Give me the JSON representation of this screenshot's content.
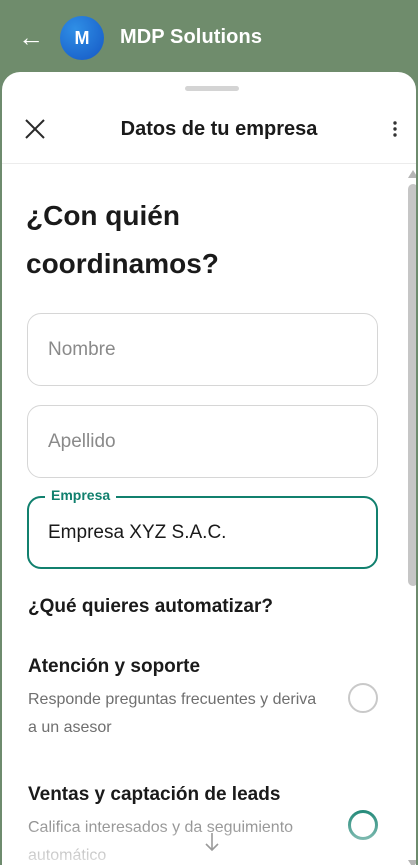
{
  "app": {
    "back_icon": "arrow-left-icon",
    "avatar_letter": "M",
    "title": "MDP Solutions",
    "header_color": "#6f8c6c"
  },
  "sheet": {
    "title": "Datos de tu empresa",
    "close_icon": "close-icon",
    "more_icon": "more-vertical-icon"
  },
  "form": {
    "heading": "¿Con quién coordinamos?",
    "nombre_placeholder": "Nombre",
    "apellido_placeholder": "Apellido",
    "empresa_label": "Empresa",
    "empresa_value": "Empresa XYZ S.A.C.",
    "accent_color": "#11806e"
  },
  "automation": {
    "title": "¿Qué quieres automatizar?",
    "options": [
      {
        "title": "Atención y soporte",
        "description": "Responde preguntas frecuentes y deriva a un asesor",
        "selected": false
      },
      {
        "title": "Ventas y captación de leads",
        "description": "Califica interesados y da seguimiento automático",
        "selected": true
      }
    ]
  }
}
